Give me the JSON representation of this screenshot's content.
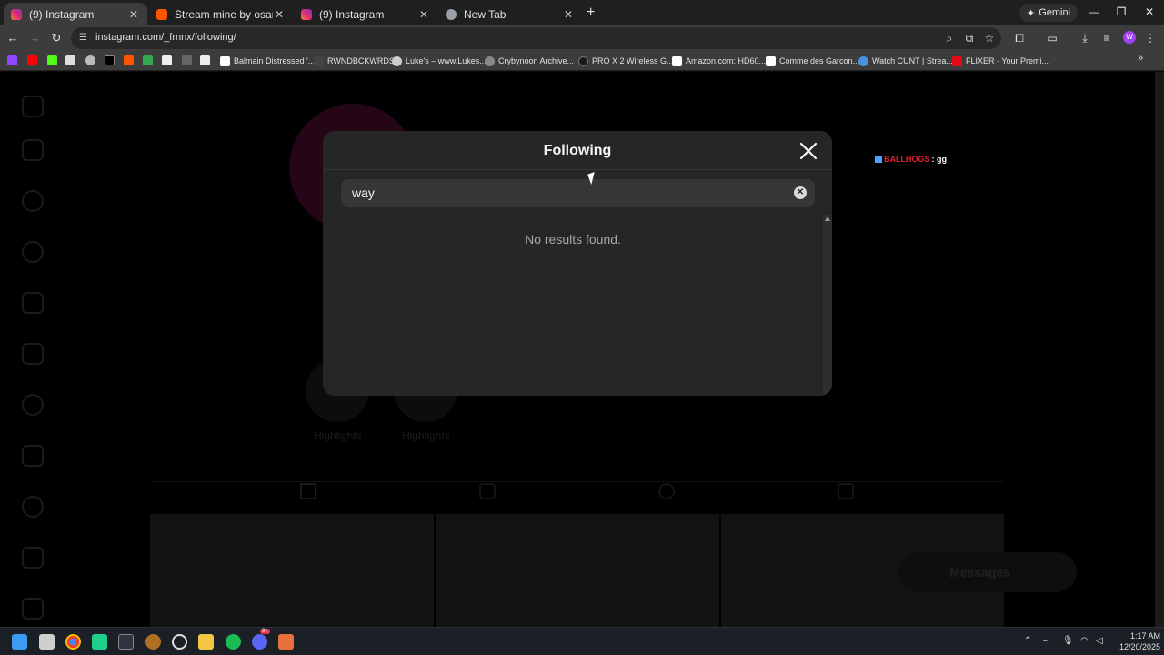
{
  "browser": {
    "tabs": [
      {
        "title": "(9) Instagram",
        "active": true,
        "favicon_color": "#e1306c"
      },
      {
        "title": "Stream mine by osamason | Lis",
        "active": false,
        "favicon_color": "#ff5500"
      },
      {
        "title": "(9) Instagram",
        "active": false,
        "favicon_color": "#e1306c"
      },
      {
        "title": "New Tab",
        "active": false,
        "favicon_color": "#9aa0a6"
      }
    ],
    "new_tab_symbol": "+",
    "gemini_label": "Gemini",
    "url": "instagram.com/_frnnx/following/",
    "profile_initial": "W",
    "bookmarks": [
      {
        "label": "Balmain Distressed '...",
        "favicon_color": "#ffffff"
      },
      {
        "label": "RWNDBCKWRDS",
        "favicon_color": "#444444"
      },
      {
        "label": "Luke's – www.Lukes....",
        "favicon_color": "#cccccc"
      },
      {
        "label": "Crybynoon Archive...",
        "favicon_color": "#888888"
      },
      {
        "label": "PRO X 2 Wireless G...",
        "favicon_color": "#1a1a1a"
      },
      {
        "label": "Amazon.com: HD60...",
        "favicon_color": "#ffffff"
      },
      {
        "label": "Comme des Garcon...",
        "favicon_color": "#ffffff"
      },
      {
        "label": "Watch CUNT | Strea...",
        "favicon_color": "#4a90e2"
      },
      {
        "label": "FLIXER - Your Premi...",
        "favicon_color": "#e50914"
      }
    ]
  },
  "background_page": {
    "highlights": [
      "Highlights",
      "Highlights"
    ],
    "messages_label": "Messages",
    "notification_text": "BALLHOGS",
    "notification_suffix": ": gg"
  },
  "modal": {
    "title": "Following",
    "search_value": "way",
    "empty_state": "No results found."
  },
  "taskbar": {
    "time": "1:17 AM",
    "date": "12/20/2025",
    "discord_badge": "9+"
  },
  "colors": {
    "accent_instagram": "#e1306c",
    "modal_bg": "#262626",
    "search_bg": "#363636"
  }
}
